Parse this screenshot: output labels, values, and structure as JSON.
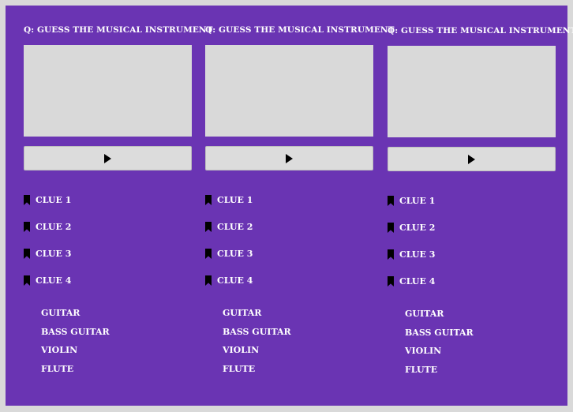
{
  "columns": [
    {
      "question": "Q: GUESS THE MUSICAL INSTRUMENT",
      "clues": [
        "CLUE 1",
        "CLUE 2",
        "CLUE 3",
        "CLUE 4"
      ],
      "options": [
        "GUITAR",
        "BASS GUITAR",
        "VIOLIN",
        "FLUTE"
      ]
    },
    {
      "question": "Q: GUESS THE MUSICAL INSTRUMENT",
      "clues": [
        "CLUE 1",
        "CLUE 2",
        "CLUE 3",
        "CLUE 4"
      ],
      "options": [
        "GUITAR",
        "BASS GUITAR",
        "VIOLIN",
        "FLUTE"
      ]
    },
    {
      "question": "Q: GUESS THE MUSICAL INSTRUMENT",
      "clues": [
        "CLUE 1",
        "CLUE 2",
        "CLUE 3",
        "CLUE 4"
      ],
      "options": [
        "GUITAR",
        "BASS GUITAR",
        "VIOLIN",
        "FLUTE"
      ]
    }
  ],
  "icons": {
    "play": "play-icon",
    "clue": "bookmark-icon"
  },
  "colors": {
    "background": "#6a34b3",
    "placeholder": "#d9d9d9",
    "text": "#ffffff"
  }
}
